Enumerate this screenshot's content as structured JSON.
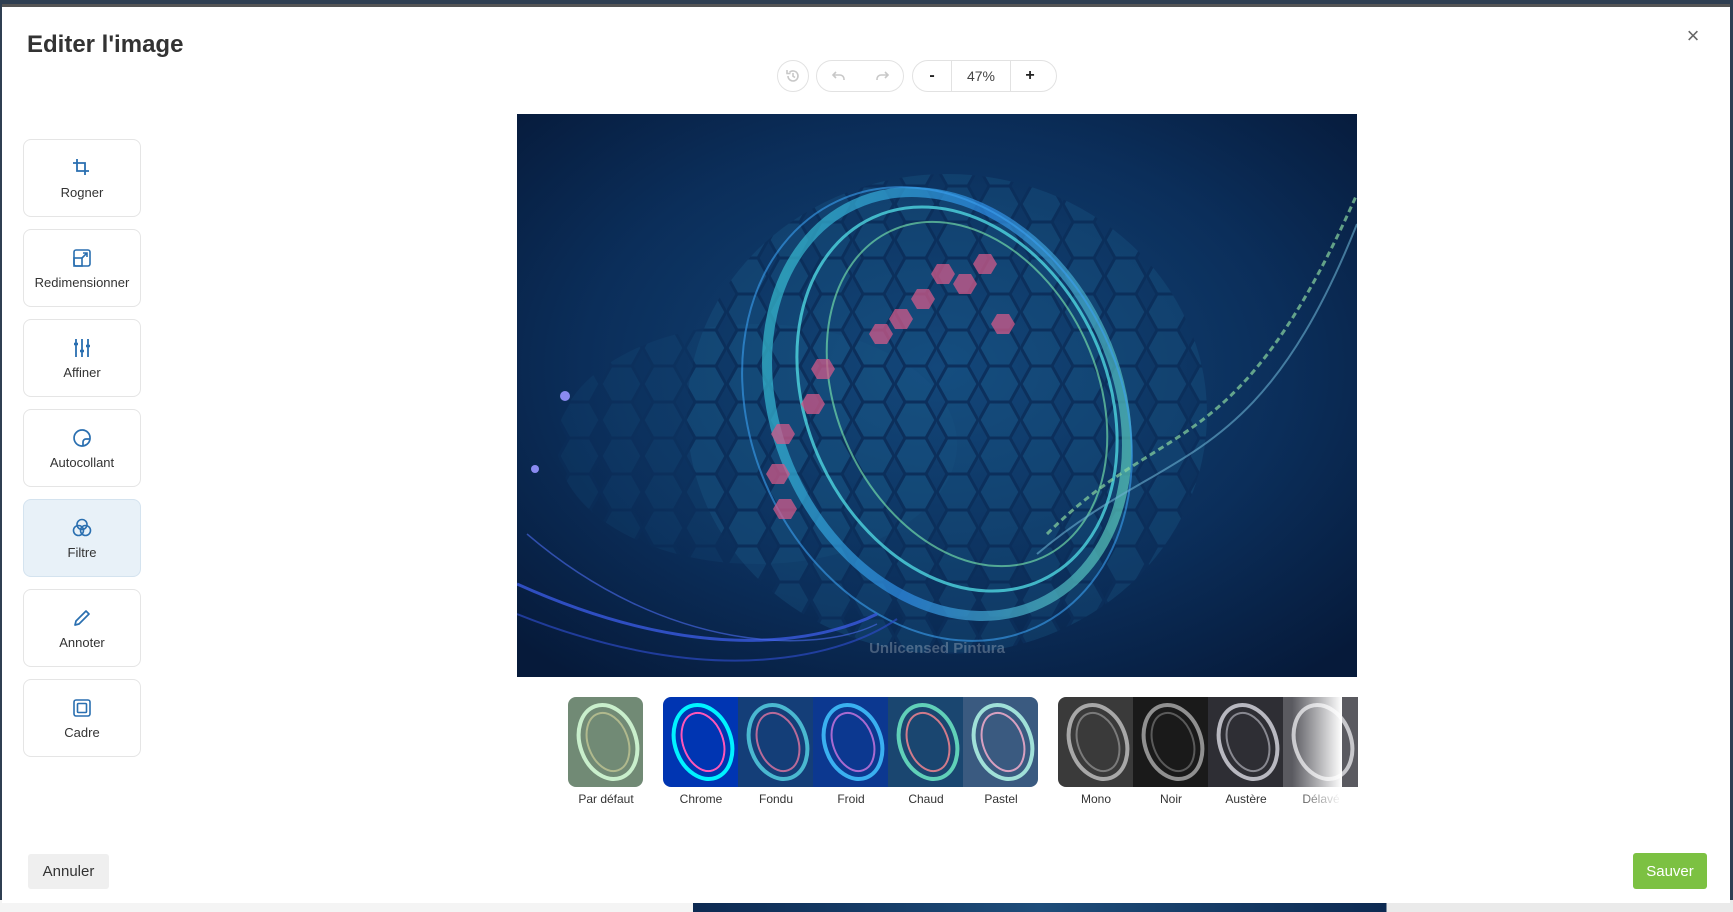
{
  "dialog": {
    "title": "Editer l'image",
    "close_icon": "close-icon",
    "close_glyph": "×"
  },
  "toolbar": {
    "history_icon": "history-icon",
    "undo_icon": "undo-icon",
    "redo_icon": "redo-icon",
    "zoom_out_label": "-",
    "zoom_value": "47%",
    "zoom_in_label": "+"
  },
  "tools": [
    {
      "label": "Rogner",
      "icon": "crop-icon",
      "active": false
    },
    {
      "label": "Redimensionner",
      "icon": "resize-icon",
      "active": false
    },
    {
      "label": "Affiner",
      "icon": "sliders-icon",
      "active": false
    },
    {
      "label": "Autocollant",
      "icon": "sticker-icon",
      "active": false
    },
    {
      "label": "Filtre",
      "icon": "filter-icon",
      "active": true
    },
    {
      "label": "Annoter",
      "icon": "pencil-icon",
      "active": false
    },
    {
      "label": "Cadre",
      "icon": "frame-icon",
      "active": false
    }
  ],
  "image": {
    "watermark": "Unlicensed Pintura"
  },
  "filters": [
    {
      "label": "Par défaut"
    },
    {
      "label": "Chrome"
    },
    {
      "label": "Fondu"
    },
    {
      "label": "Froid"
    },
    {
      "label": "Chaud"
    },
    {
      "label": "Pastel"
    },
    {
      "label": "Mono"
    },
    {
      "label": "Noir"
    },
    {
      "label": "Austère"
    },
    {
      "label": "Délavé"
    }
  ],
  "footer": {
    "cancel_label": "Annuler",
    "save_label": "Sauver"
  },
  "colors": {
    "accent": "#7cc142",
    "active_tool_bg": "#e8f1f8",
    "icon_blue": "#2a6fb0"
  }
}
